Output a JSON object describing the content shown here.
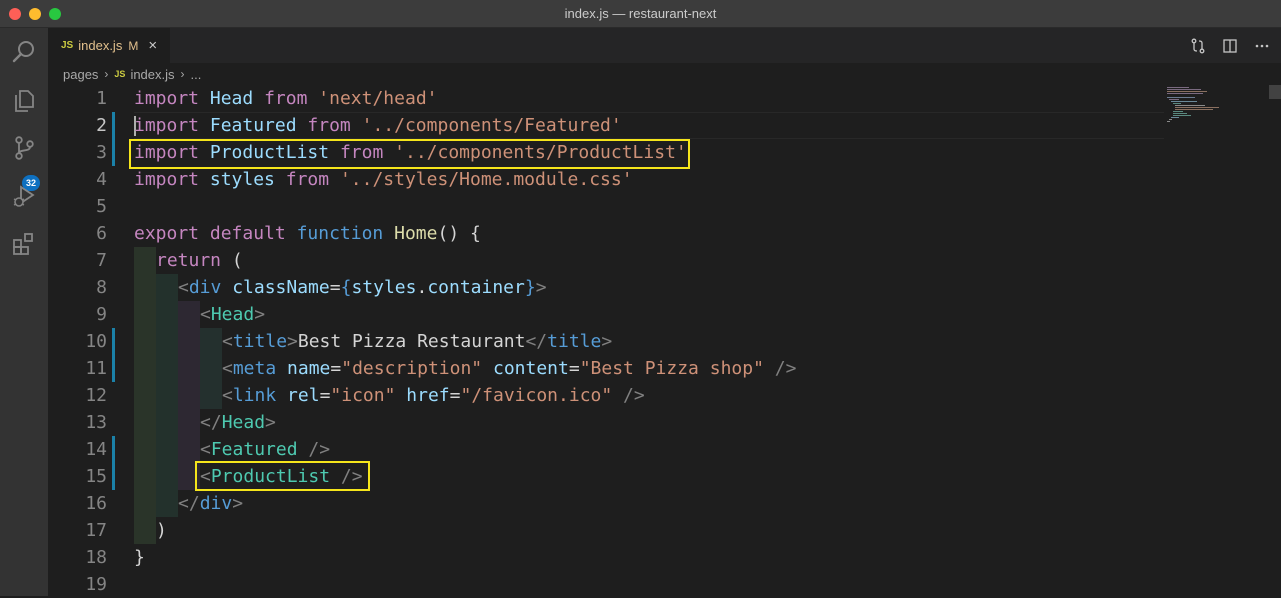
{
  "window": {
    "title": "index.js — restaurant-next"
  },
  "activity_bar": {
    "items": [
      {
        "name": "explorer",
        "icon": "files-icon"
      },
      {
        "name": "search",
        "icon": "search-icon"
      },
      {
        "name": "source-control",
        "icon": "source-control-icon",
        "badge": "32"
      },
      {
        "name": "run-debug",
        "icon": "run-debug-icon"
      },
      {
        "name": "extensions",
        "icon": "extensions-icon"
      }
    ]
  },
  "tab": {
    "lang_icon": "JS",
    "filename": "index.js",
    "status": "M",
    "close": "×"
  },
  "editor_actions": [
    {
      "name": "open-changes",
      "icon": "git-compare-icon"
    },
    {
      "name": "split-editor",
      "icon": "split-editor-icon"
    },
    {
      "name": "more-actions",
      "icon": "ellipsis-icon"
    }
  ],
  "breadcrumb": {
    "folder": "pages",
    "lang_icon": "JS",
    "file": "index.js",
    "tail": "..."
  },
  "editor": {
    "line_numbers": [
      "1",
      "2",
      "3",
      "4",
      "5",
      "6",
      "7",
      "8",
      "9",
      "10",
      "11",
      "12",
      "13",
      "14",
      "15",
      "16",
      "17",
      "18",
      "19"
    ],
    "current_line": "2",
    "modified_lines": [
      "2",
      "3",
      "10",
      "11",
      "14",
      "15"
    ],
    "highlighted_regions": [
      {
        "line": "3",
        "text": "import ProductList from '../components/ProductList'"
      },
      {
        "line": "15",
        "text": "<ProductList />"
      }
    ],
    "tokens": {
      "l1": [
        "import",
        " ",
        "Head",
        " ",
        "from",
        " ",
        "'next/head'"
      ],
      "l2": [
        "import",
        " ",
        "Featured",
        " ",
        "from",
        " ",
        "'../components/Featured'"
      ],
      "l3": [
        "import",
        " ",
        "ProductList",
        " ",
        "from",
        " ",
        "'../components/ProductList'"
      ],
      "l4": [
        "import",
        " ",
        "styles",
        " ",
        "from",
        " ",
        "'../styles/Home.module.css'"
      ],
      "l6": [
        "export",
        " ",
        "default",
        " ",
        "function",
        " ",
        "Home",
        "()",
        " {"
      ],
      "l7": [
        "return",
        " ("
      ],
      "l8": [
        "<",
        "div",
        " ",
        "className",
        "=",
        "{",
        "styles",
        ".",
        "container",
        "}",
        ">"
      ],
      "l9": [
        "<",
        "Head",
        ">"
      ],
      "l10": [
        "<",
        "title",
        ">",
        "Best Pizza Restaurant",
        "</",
        "title",
        ">"
      ],
      "l11": [
        "<",
        "meta",
        " ",
        "name",
        "=",
        "\"description\"",
        " ",
        "content",
        "=",
        "\"Best Pizza shop\"",
        " />"
      ],
      "l12": [
        "<",
        "link",
        " ",
        "rel",
        "=",
        "\"icon\"",
        " ",
        "href",
        "=",
        "\"/favicon.ico\"",
        " />"
      ],
      "l13": [
        "</",
        "Head",
        ">"
      ],
      "l14": [
        "<",
        "Featured",
        " />"
      ],
      "l15": [
        "<",
        "ProductList",
        " />"
      ],
      "l16": [
        "</",
        "div",
        ">"
      ],
      "l17": [
        ")"
      ],
      "l18": [
        "}"
      ]
    }
  },
  "colors": {
    "keyword": "#c586c0",
    "identifier": "#9cdcfe",
    "string": "#ce9178",
    "function": "#dcdcaa",
    "builtin": "#569cd6",
    "tag": "#4ec9b0",
    "punctuation": "#808080",
    "highlight_box": "#f5e51b",
    "modified_gutter": "#1b81a8"
  }
}
